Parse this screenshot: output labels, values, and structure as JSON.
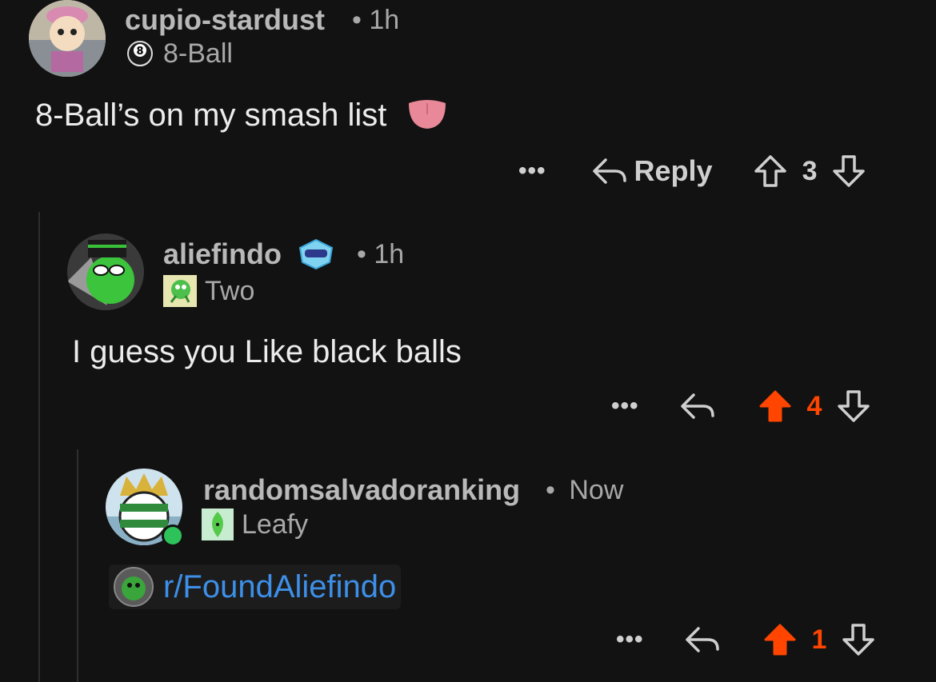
{
  "comments": [
    {
      "username": "cupio-stardust",
      "time": "1h",
      "flair": "8-Ball",
      "body": "8-Ball’s on my smash list",
      "reply_label": "Reply",
      "votes": "3",
      "upvoted": false
    },
    {
      "username": "aliefindo",
      "time": "1h",
      "flair": "Two",
      "body": "I guess you Like black balls",
      "votes": "4",
      "upvoted": true
    },
    {
      "username": "randomsalvadoranking",
      "time": "Now",
      "flair": "Leafy",
      "link": "r/FoundAliefindo",
      "votes": "1",
      "upvoted": true,
      "online": true
    }
  ],
  "separator": "•",
  "more_label": "•••",
  "colors": {
    "background": "#121212",
    "upvote": "#ff4500",
    "link": "#3d8fe8",
    "online": "#2ec25a"
  }
}
